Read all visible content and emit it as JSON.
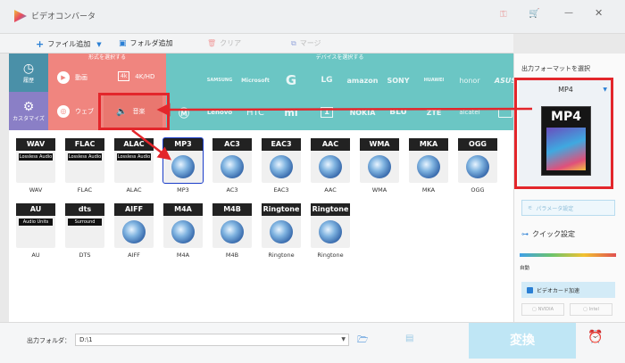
{
  "window": {
    "title": "ビデオコンバータ"
  },
  "toolbar": {
    "add_file": "ファイル追加",
    "add_folder": "フォルダ追加",
    "clear": "クリア",
    "merge": "マージ"
  },
  "left_nav": {
    "history": "履歴",
    "customize": "カスタマイズ"
  },
  "format_section": {
    "title": "形式を選択する",
    "video": "動画",
    "hd": "4K/HD",
    "web": "ウェブ",
    "music": "音楽"
  },
  "device_section": {
    "title": "デバイスを選択する",
    "brands_row1": [
      "",
      "SAMSUNG",
      "Microsoft",
      "G",
      "LG",
      "amazon",
      "SONY",
      "HUAWEI",
      "honor",
      "ASUS"
    ],
    "brands_row2": [
      "",
      "Lenovo",
      "HTC",
      "mi",
      "1",
      "NOKIA",
      "BLU",
      "ZTE",
      "alcatel",
      ""
    ]
  },
  "formats": [
    {
      "name": "WAV",
      "sub": "Lossless Audio",
      "label": "WAV"
    },
    {
      "name": "FLAC",
      "sub": "Lossless Audio",
      "label": "FLAC"
    },
    {
      "name": "ALAC",
      "sub": "Lossless Audio",
      "label": "ALAC"
    },
    {
      "name": "MP3",
      "sub": "",
      "label": "MP3"
    },
    {
      "name": "AC3",
      "sub": "",
      "label": "AC3"
    },
    {
      "name": "EAC3",
      "sub": "",
      "label": "EAC3"
    },
    {
      "name": "AAC",
      "sub": "",
      "label": "AAC"
    },
    {
      "name": "WMA",
      "sub": "",
      "label": "WMA"
    },
    {
      "name": "MKA",
      "sub": "",
      "label": "MKA"
    },
    {
      "name": "OGG",
      "sub": "",
      "label": "OGG"
    },
    {
      "name": "AU",
      "sub": "Audio Units",
      "label": "AU"
    },
    {
      "name": "dts",
      "sub": "Surround",
      "label": "DTS"
    },
    {
      "name": "AIFF",
      "sub": "",
      "label": "AIFF"
    },
    {
      "name": "M4A",
      "sub": "",
      "label": "M4A"
    },
    {
      "name": "M4B",
      "sub": "",
      "label": "M4B"
    },
    {
      "name": "Ringtone",
      "sub": "",
      "label": "Ringtone"
    },
    {
      "name": "Ringtone",
      "sub": "",
      "label": "Ringtone"
    }
  ],
  "right_panel": {
    "output_format_title": "出力フォーマットを選択",
    "selected_format": "MP4",
    "param_settings": "パラメータ設定",
    "quick_settings": "クイック設定",
    "auto": "自動",
    "gpu_accel": "ビデオカード加速",
    "nvidia": "NVIDIA",
    "intel": "Intel"
  },
  "bottom": {
    "output_folder_label": "出力フォルダ：",
    "output_folder_value": "D:\\1",
    "convert": "変換"
  },
  "colors": {
    "accent_red": "#e3262b",
    "format_bg": "#f0857f",
    "device_bg": "#6bc6c4",
    "nav_bg": "#4a90a8",
    "convert_bg": "#bfe6f5"
  }
}
